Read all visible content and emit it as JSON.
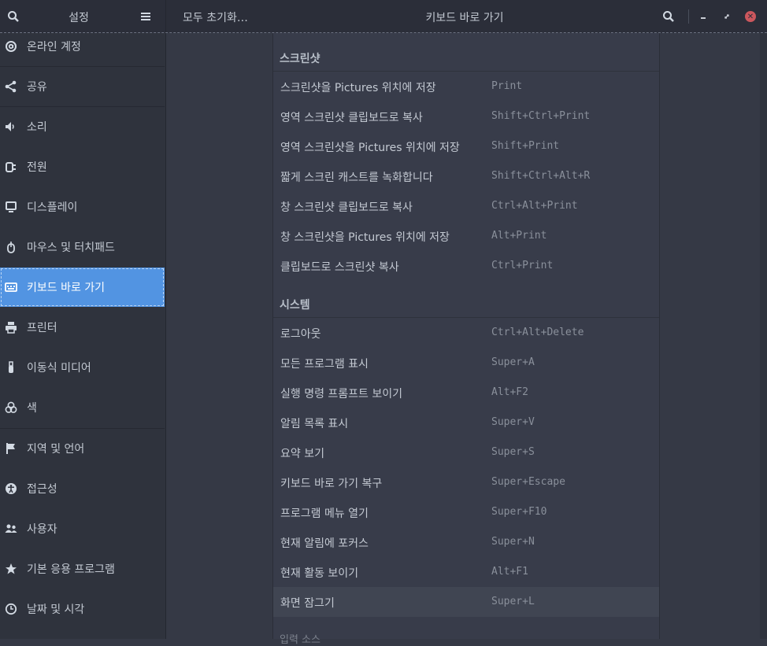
{
  "header": {
    "sidebar_title": "설정",
    "reset_label": "모두 초기화…",
    "main_title": "키보드 바로 가기",
    "icons": [
      "search-icon",
      "menu-icon",
      "minimize-icon",
      "maximize-icon",
      "close-icon"
    ]
  },
  "sidebar": {
    "items": [
      {
        "label": "온라인 계정",
        "icon": "at-icon"
      },
      {
        "label": "공유",
        "icon": "share-icon"
      },
      {
        "label": "소리",
        "icon": "speaker-icon"
      },
      {
        "label": "전원",
        "icon": "power-plug-icon"
      },
      {
        "label": "디스플레이",
        "icon": "display-icon"
      },
      {
        "label": "마우스 및 터치패드",
        "icon": "mouse-icon"
      },
      {
        "label": "키보드 바로 가기",
        "icon": "keyboard-icon",
        "active": true
      },
      {
        "label": "프린터",
        "icon": "printer-icon"
      },
      {
        "label": "이동식 미디어",
        "icon": "usb-icon"
      },
      {
        "label": "색",
        "icon": "color-icon"
      },
      {
        "label": "지역 및 언어",
        "icon": "flag-icon"
      },
      {
        "label": "접근성",
        "icon": "accessibility-icon"
      },
      {
        "label": "사용자",
        "icon": "users-icon"
      },
      {
        "label": "기본 응용 프로그램",
        "icon": "star-icon"
      },
      {
        "label": "날짜 및 시각",
        "icon": "clock-icon"
      }
    ]
  },
  "main": {
    "sections": [
      {
        "title": "스크린샷",
        "rows": [
          {
            "name": "스크린샷을 Pictures 위치에 저장",
            "accel": "Print"
          },
          {
            "name": "영역 스크린샷 클립보드로 복사",
            "accel": "Shift+Ctrl+Print"
          },
          {
            "name": "영역 스크린샷을 Pictures 위치에 저장",
            "accel": "Shift+Print"
          },
          {
            "name": "짧게 스크린 캐스트를 녹화합니다",
            "accel": "Shift+Ctrl+Alt+R"
          },
          {
            "name": "창 스크린샷 클립보드로 복사",
            "accel": "Ctrl+Alt+Print"
          },
          {
            "name": "창 스크린샷을 Pictures 위치에 저장",
            "accel": "Alt+Print"
          },
          {
            "name": "클립보드로 스크린샷 복사",
            "accel": "Ctrl+Print"
          }
        ]
      },
      {
        "title": "시스템",
        "rows": [
          {
            "name": "로그아웃",
            "accel": "Ctrl+Alt+Delete"
          },
          {
            "name": "모든 프로그램 표시",
            "accel": "Super+A"
          },
          {
            "name": "실행 명령 프롬프트 보이기",
            "accel": "Alt+F2"
          },
          {
            "name": "알림 목록 표시",
            "accel": "Super+V"
          },
          {
            "name": "요약 보기",
            "accel": "Super+S"
          },
          {
            "name": "키보드 바로 가기 복구",
            "accel": "Super+Escape"
          },
          {
            "name": "프로그램 메뉴 열기",
            "accel": "Super+F10"
          },
          {
            "name": "현재 알림에 포커스",
            "accel": "Super+N"
          },
          {
            "name": "현재 활동 보이기",
            "accel": "Alt+F1"
          },
          {
            "name": "화면 잠그기",
            "accel": "Super+L",
            "highlighted": true
          }
        ]
      }
    ],
    "partial_section_title": "입력 소스"
  },
  "colors": {
    "accent": "#5294e2",
    "close": "#cc575d",
    "header_bg": "#2b2e39",
    "sidebar_bg": "#2f333d",
    "panel_bg": "#383c4a"
  }
}
